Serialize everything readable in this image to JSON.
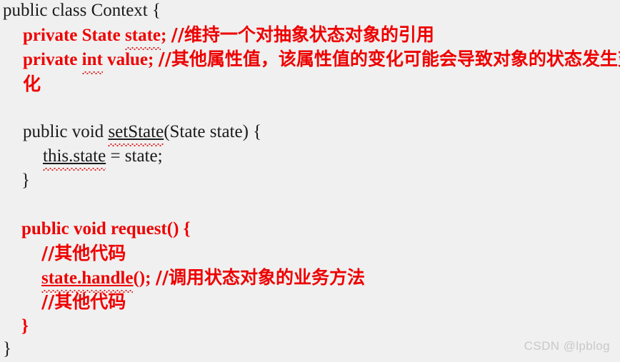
{
  "document": {
    "type": "code-snippet-image",
    "language": "Java",
    "background_color": "#f0f0f0",
    "default_text_color": "#1a1a1a",
    "highlight_color": "#ee0000",
    "spellcheck_underline_color": "#e02020"
  },
  "code": {
    "lines": [
      {
        "id": "line-1",
        "text": "public class Context {",
        "color": "black",
        "indent": 0
      },
      {
        "id": "line-2",
        "prefix": "private State ",
        "squiggle": "state",
        "suffix": "; ",
        "comment": "//维持一个对抽象状态对象的引用",
        "color": "red",
        "indent": 1
      },
      {
        "id": "line-3",
        "prefix": "private ",
        "squiggle": "int",
        "suffix": " value;  ",
        "comment": "//其他属性值，该属性值的变化可能会导致对象的状态发生变化",
        "color": "red",
        "indent": 1
      },
      {
        "id": "line-4",
        "text": "",
        "color": "black",
        "indent": 0
      },
      {
        "id": "line-5",
        "prefix": "public void ",
        "squiggle": "setState",
        "suffix": "(State state) {",
        "color": "black",
        "indent": 1
      },
      {
        "id": "line-6",
        "squiggle": "this.state",
        "suffix": " = state;",
        "color": "black",
        "indent": 2
      },
      {
        "id": "line-7",
        "text": "}",
        "color": "black",
        "indent": 1
      },
      {
        "id": "line-8",
        "text": "",
        "color": "black",
        "indent": 0
      },
      {
        "id": "line-9",
        "text": "public void request() {",
        "color": "red",
        "indent": 1
      },
      {
        "id": "line-10",
        "comment": "//其他代码",
        "color": "red",
        "indent": 2
      },
      {
        "id": "line-11",
        "squiggle": "state.handle",
        "suffix": "(); ",
        "comment": "//调用状态对象的业务方法",
        "color": "red",
        "indent": 2
      },
      {
        "id": "line-12",
        "comment": "//其他代码",
        "color": "red",
        "indent": 2
      },
      {
        "id": "line-13",
        "text": "}",
        "color": "red",
        "indent": 1
      },
      {
        "id": "line-14",
        "text": "}",
        "color": "black",
        "indent": 0
      }
    ],
    "l1_text": "public class Context {",
    "l2_kw": "private State ",
    "l2_sq": "state",
    "l2_semi": "; ",
    "l2_comment": "//维持一个对抽象状态对象的引用",
    "l3_kw": "private ",
    "l3_sq": "int",
    "l3_rest": " value;  ",
    "l3_comment": "//其他属性值，该属性值的变化可能会导致对象的状态发生变化",
    "l5_kw": "public void ",
    "l5_sq": "setState",
    "l5_rest": "(State state) {",
    "l6_sq": "this.state",
    "l6_rest": " = state;",
    "l7_text": "}",
    "l9_text": "public void request() {",
    "l10_comment": "//其他代码",
    "l11_sq": "state.handle",
    "l11_rest": "(); ",
    "l11_comment": "//调用状态对象的业务方法",
    "l12_comment": "//其他代码",
    "l13_text": "}",
    "l14_text": "}"
  },
  "watermark": {
    "text": "CSDN @lpblog",
    "color": "#c9c9c9"
  }
}
